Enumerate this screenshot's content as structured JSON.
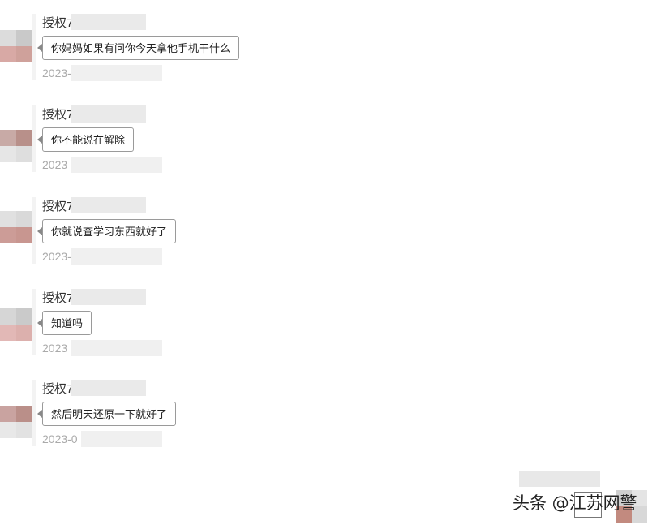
{
  "chat": {
    "messages": [
      {
        "sender": "授权7",
        "text": "你妈妈如果有问你今天拿他手机干什么",
        "date": "2023-"
      },
      {
        "sender": "授权7",
        "text": "你不能说在解除",
        "date": "2023"
      },
      {
        "sender": "授权7",
        "text": "你就说查学习东西就好了",
        "date": "2023-"
      },
      {
        "sender": "授权7",
        "text": "知道吗",
        "date": "2023"
      },
      {
        "sender": "授权7",
        "text": "然后明天还原一下就好了",
        "date": "2023-0"
      }
    ]
  },
  "watermark": {
    "text": "头条 @江苏网警"
  },
  "colors": {
    "bubble_border": "#9a9a9a",
    "date_text": "#aaaaaa",
    "avatar_pink": "#d9b3b0",
    "avatar_brown": "#b8908a",
    "avatar_gray": "#d6d6d6"
  },
  "icons": {
    "avatar": "pixelated-avatar",
    "pointer": "bubble-pointer-icon"
  }
}
